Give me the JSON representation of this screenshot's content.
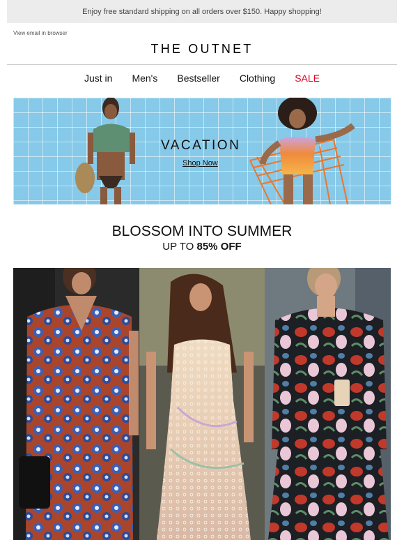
{
  "banner": {
    "text": "Enjoy free standard shipping on all orders over $150. Happy shopping!"
  },
  "header": {
    "view_in_browser": "View email in browser",
    "logo": "THE OUTNET"
  },
  "nav": {
    "items": [
      "Just in",
      "Men's",
      "Bestseller",
      "Clothing",
      "SALE"
    ],
    "sale_color": "#e0001b"
  },
  "hero": {
    "title": "VACATION",
    "cta": "Shop Now"
  },
  "promo": {
    "headline": "BLOSSOM INTO SUMMER",
    "subline_prefix": "UP TO",
    "subline_discount": "85% OFF"
  },
  "tiles": [
    {
      "name": "floral-wrap-dress"
    },
    {
      "name": "lace-slip-gown"
    },
    {
      "name": "floral-print-set"
    }
  ]
}
